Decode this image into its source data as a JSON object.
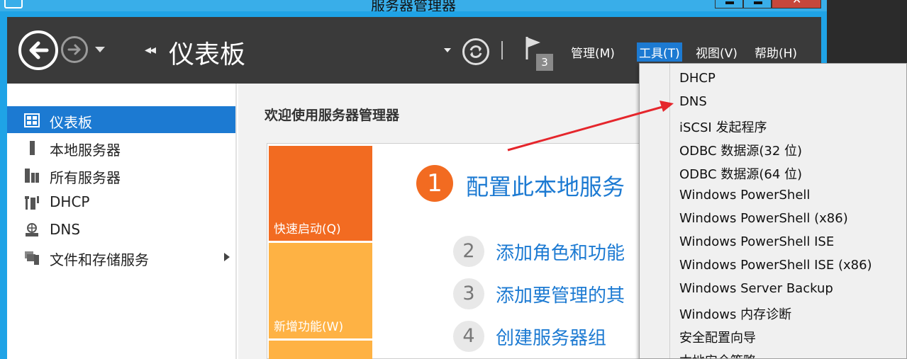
{
  "window": {
    "title": "服务器管理器",
    "icon": "server-manager-icon"
  },
  "toolbar": {
    "breadcrumb_title": "仪表板",
    "breadcrumb_chevron": "◂◂",
    "notification_count": "3",
    "menus": [
      {
        "label": "管理(M)",
        "active": false
      },
      {
        "label": "工具(T)",
        "active": true
      },
      {
        "label": "视图(V)",
        "active": false
      },
      {
        "label": "帮助(H)",
        "active": false
      }
    ]
  },
  "sidebar": {
    "items": [
      {
        "label": "仪表板",
        "icon": "dashboard-icon",
        "selected": true
      },
      {
        "label": "本地服务器",
        "icon": "local-server-icon",
        "selected": false
      },
      {
        "label": "所有服务器",
        "icon": "all-servers-icon",
        "selected": false
      },
      {
        "label": "DHCP",
        "icon": "dhcp-icon",
        "selected": false
      },
      {
        "label": "DNS",
        "icon": "dns-icon",
        "selected": false
      },
      {
        "label": "文件和存储服务",
        "icon": "file-storage-icon",
        "selected": false,
        "has_submenu": true
      }
    ]
  },
  "main": {
    "welcome_title": "欢迎使用服务器管理器",
    "tiles": {
      "quick_start": "快速启动(Q)",
      "whats_new": "新增功能(W)"
    },
    "steps": [
      {
        "number": "1",
        "text": "配置此本地服务"
      },
      {
        "number": "2",
        "text": "添加角色和功能"
      },
      {
        "number": "3",
        "text": "添加要管理的其"
      },
      {
        "number": "4",
        "text": "创建服务器组"
      }
    ]
  },
  "tools_menu": {
    "items": [
      "DHCP",
      "DNS",
      "iSCSI 发起程序",
      "ODBC 数据源(32 位)",
      "ODBC 数据源(64 位)",
      "Windows PowerShell",
      "Windows PowerShell (x86)",
      "Windows PowerShell ISE",
      "Windows PowerShell ISE (x86)",
      "Windows Server Backup",
      "Windows 内存诊断",
      "安全配置向导",
      "本地安全策略"
    ]
  },
  "colors": {
    "accent": "#1c7ad2",
    "toolbar": "#3a3a3a",
    "tile_orange": "#f26b21",
    "tile_yellow": "#feb244",
    "annotation_arrow": "#e5262c"
  }
}
